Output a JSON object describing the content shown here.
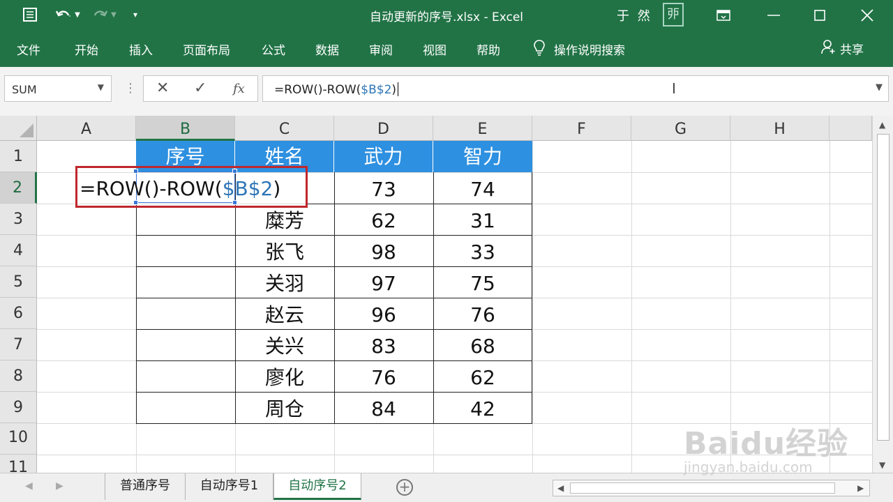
{
  "window": {
    "title": "自动更新的序号.xlsx  -  Excel",
    "user": "于 然",
    "avatar_glyph": "戼"
  },
  "ribbon": {
    "tabs": [
      "文件",
      "开始",
      "插入",
      "页面布局",
      "公式",
      "数据",
      "审阅",
      "视图",
      "帮助"
    ],
    "tell_me": "操作说明搜索",
    "share": "共享"
  },
  "formula_bar": {
    "name_box": "SUM",
    "formula_prefix": "=ROW()-ROW(",
    "formula_ref": "$B$2",
    "formula_suffix": ")",
    "fx_label": "fx"
  },
  "grid": {
    "columns": [
      "A",
      "B",
      "C",
      "D",
      "E",
      "F",
      "G",
      "H"
    ],
    "rows": [
      "1",
      "2",
      "3",
      "4",
      "5",
      "6",
      "7",
      "8",
      "9",
      "10",
      "11"
    ],
    "selected_column": "B",
    "selected_row": "2",
    "table": {
      "headers": [
        "序号",
        "姓名",
        "武力",
        "智力"
      ],
      "rows": [
        [
          "",
          "",
          "73",
          "74"
        ],
        [
          "",
          "糜芳",
          "62",
          "31"
        ],
        [
          "",
          "张飞",
          "98",
          "33"
        ],
        [
          "",
          "关羽",
          "97",
          "75"
        ],
        [
          "",
          "赵云",
          "96",
          "76"
        ],
        [
          "",
          "关兴",
          "83",
          "68"
        ],
        [
          "",
          "廖化",
          "76",
          "62"
        ],
        [
          "",
          "周仓",
          "84",
          "42"
        ]
      ]
    },
    "editing_cell": {
      "prefix": "=ROW()-ROW(",
      "ref": "$B$2",
      "suffix": ")"
    }
  },
  "sheets": {
    "tabs": [
      "普通序号",
      "自动序号1",
      "自动序号2"
    ],
    "active_index": 2
  },
  "watermark": {
    "logo": "Baidu经验",
    "url": "jingyan.baidu.com"
  },
  "colors": {
    "excel_green": "#217346",
    "table_header_blue": "#2e90e0",
    "highlight_red": "#c0272d",
    "reference_blue": "#2e75b6"
  }
}
